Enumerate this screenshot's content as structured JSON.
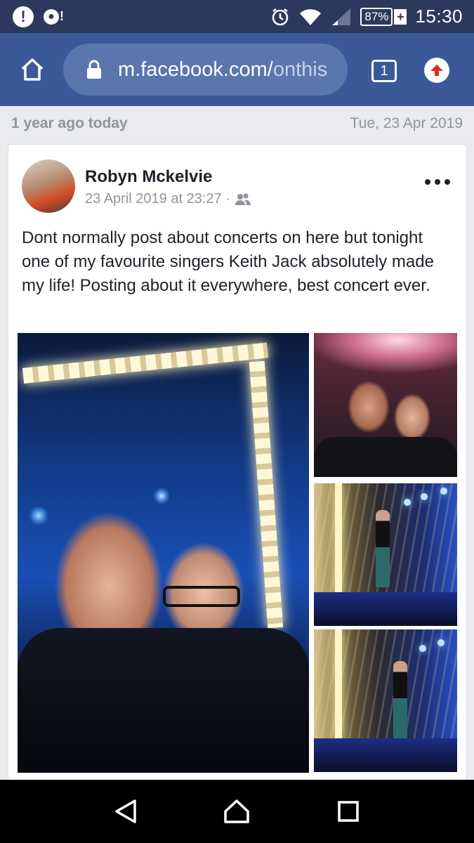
{
  "status_bar": {
    "alert_icon": "!",
    "notif_icon": "!",
    "battery_percent": "87%",
    "battery_plus": "+",
    "clock": "15:30"
  },
  "browser": {
    "url_domain": "m.facebook.com/",
    "url_path": "onthis",
    "tab_count": "1"
  },
  "memory": {
    "label": "1 year ago today",
    "date": "Tue, 23 Apr 2019"
  },
  "post": {
    "author": "Robyn Mckelvie",
    "timestamp": "23 April 2019 at 23:27",
    "separator": "·",
    "audience_icon": "friends-icon",
    "text": "Dont normally post about concerts on here but tonight one of my favourite singers Keith Jack absolutely made my life! Posting about it everywhere, best concert ever."
  },
  "colors": {
    "status_bar": "#2b3a5c",
    "browser_bar": "#3b5998",
    "url_pill": "#5b76ad",
    "background": "#e9ebee",
    "text_primary": "#1d2129",
    "text_secondary": "#90949c"
  }
}
